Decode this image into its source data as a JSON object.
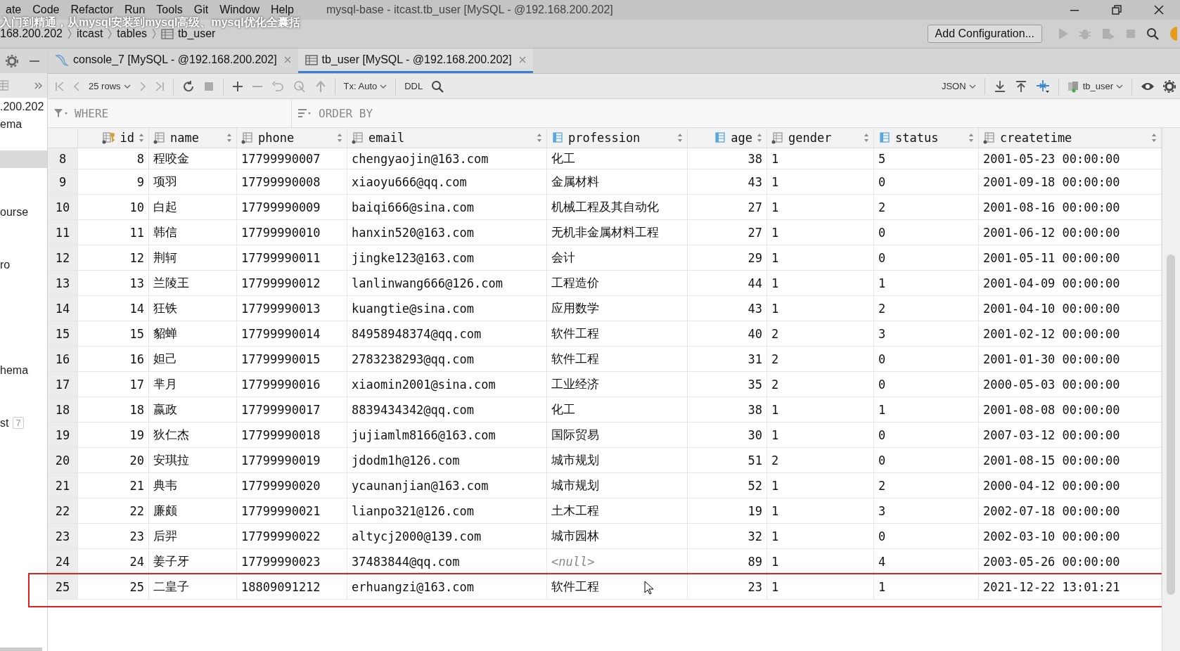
{
  "menu": {
    "items": [
      "ate",
      "Code",
      "Refactor",
      "Run",
      "Tools",
      "Git",
      "Window",
      "Help"
    ],
    "title": "mysql-base - itcast.tb_user [MySQL - @192.168.200.202]"
  },
  "caption": "入门到精通，从mysql安装到mysql高级、mysql优化全囊括",
  "breadcrumb": [
    "168.200.202",
    "itcast",
    "tables",
    "tb_user"
  ],
  "run_config": {
    "label": "Add Configuration..."
  },
  "sidebar": {
    "items": [
      ".200.202",
      "ema",
      "ourse",
      "ro",
      "hema",
      "st"
    ],
    "badge": "7"
  },
  "tabs": [
    {
      "label": "console_7 [MySQL - @192.168.200.202]",
      "kind": "console",
      "selected": false
    },
    {
      "label": "tb_user [MySQL - @192.168.200.202]",
      "kind": "table",
      "selected": true
    }
  ],
  "toolbar": {
    "rows": "25 rows",
    "tx": "Tx: Auto",
    "ddl": "DDL",
    "format": "JSON",
    "datasource": "tb_user"
  },
  "filter": {
    "where": "WHERE",
    "order_by": "ORDER BY"
  },
  "table": {
    "columns": [
      {
        "label": "id",
        "kind": "key",
        "numeric": true
      },
      {
        "label": "name",
        "kind": "column",
        "numeric": false
      },
      {
        "label": "phone",
        "kind": "column",
        "numeric": false
      },
      {
        "label": "email",
        "kind": "column",
        "numeric": false
      },
      {
        "label": "profession",
        "kind": "indexed",
        "numeric": false
      },
      {
        "label": "age",
        "kind": "indexed",
        "numeric": true
      },
      {
        "label": "gender",
        "kind": "column",
        "numeric": false
      },
      {
        "label": "status",
        "kind": "indexed",
        "numeric": false
      },
      {
        "label": "createtime",
        "kind": "column",
        "numeric": false
      }
    ],
    "rows": [
      {
        "number": "8",
        "cells": [
          "8",
          "程咬金",
          "17799990007",
          "chengyaojin@163.com",
          "化工",
          "38",
          "1",
          "5",
          "2001-05-23 00:00:00"
        ],
        "null_cell": false,
        "highlighted": false
      },
      {
        "number": "9",
        "cells": [
          "9",
          "项羽",
          "17799990008",
          "xiaoyu666@qq.com",
          "金属材料",
          "43",
          "1",
          "0",
          "2001-09-18 00:00:00"
        ],
        "null_cell": false,
        "highlighted": false
      },
      {
        "number": "10",
        "cells": [
          "10",
          "白起",
          "17799990009",
          "baiqi666@sina.com",
          "机械工程及其自动化",
          "27",
          "1",
          "2",
          "2001-08-16 00:00:00"
        ],
        "null_cell": false,
        "highlighted": false
      },
      {
        "number": "11",
        "cells": [
          "11",
          "韩信",
          "17799990010",
          "hanxin520@163.com",
          "无机非金属材料工程",
          "27",
          "1",
          "0",
          "2001-06-12 00:00:00"
        ],
        "null_cell": false,
        "highlighted": false
      },
      {
        "number": "12",
        "cells": [
          "12",
          "荆轲",
          "17799990011",
          "jingke123@163.com",
          "会计",
          "29",
          "1",
          "0",
          "2001-05-11 00:00:00"
        ],
        "null_cell": false,
        "highlighted": false
      },
      {
        "number": "13",
        "cells": [
          "13",
          "兰陵王",
          "17799990012",
          "lanlinwang666@126.com",
          "工程造价",
          "44",
          "1",
          "1",
          "2001-04-09 00:00:00"
        ],
        "null_cell": false,
        "highlighted": false
      },
      {
        "number": "14",
        "cells": [
          "14",
          "狂铁",
          "17799990013",
          "kuangtie@sina.com",
          "应用数学",
          "43",
          "1",
          "2",
          "2001-04-10 00:00:00"
        ],
        "null_cell": false,
        "highlighted": false
      },
      {
        "number": "15",
        "cells": [
          "15",
          "貂蝉",
          "17799990014",
          "84958948374@qq.com",
          "软件工程",
          "40",
          "2",
          "3",
          "2001-02-12 00:00:00"
        ],
        "null_cell": false,
        "highlighted": false
      },
      {
        "number": "16",
        "cells": [
          "16",
          "妲己",
          "17799990015",
          "2783238293@qq.com",
          "软件工程",
          "31",
          "2",
          "0",
          "2001-01-30 00:00:00"
        ],
        "null_cell": false,
        "highlighted": false
      },
      {
        "number": "17",
        "cells": [
          "17",
          "芈月",
          "17799990016",
          "xiaomin2001@sina.com",
          "工业经济",
          "35",
          "2",
          "0",
          "2000-05-03 00:00:00"
        ],
        "null_cell": false,
        "highlighted": false
      },
      {
        "number": "18",
        "cells": [
          "18",
          "嬴政",
          "17799990017",
          "8839434342@qq.com",
          "化工",
          "38",
          "1",
          "1",
          "2001-08-08 00:00:00"
        ],
        "null_cell": false,
        "highlighted": false
      },
      {
        "number": "19",
        "cells": [
          "19",
          "狄仁杰",
          "17799990018",
          "jujiamlm8166@163.com",
          "国际贸易",
          "30",
          "1",
          "0",
          "2007-03-12 00:00:00"
        ],
        "null_cell": false,
        "highlighted": false
      },
      {
        "number": "20",
        "cells": [
          "20",
          "安琪拉",
          "17799990019",
          "jdodm1h@126.com",
          "城市规划",
          "51",
          "2",
          "0",
          "2001-08-15 00:00:00"
        ],
        "null_cell": false,
        "highlighted": false
      },
      {
        "number": "21",
        "cells": [
          "21",
          "典韦",
          "17799990020",
          "ycaunanjian@163.com",
          "城市规划",
          "52",
          "1",
          "2",
          "2000-04-12 00:00:00"
        ],
        "null_cell": false,
        "highlighted": false
      },
      {
        "number": "22",
        "cells": [
          "22",
          "廉颇",
          "17799990021",
          "lianpo321@126.com",
          "土木工程",
          "19",
          "1",
          "3",
          "2002-07-18 00:00:00"
        ],
        "null_cell": false,
        "highlighted": false
      },
      {
        "number": "23",
        "cells": [
          "23",
          "后羿",
          "17799990022",
          "altycj2000@139.com",
          "城市园林",
          "32",
          "1",
          "0",
          "2002-03-10 00:00:00"
        ],
        "null_cell": false,
        "highlighted": false
      },
      {
        "number": "24",
        "cells": [
          "24",
          "姜子牙",
          "17799990023",
          "37483844@qq.com",
          "<null>",
          "89",
          "1",
          "4",
          "2003-05-26 00:00:00"
        ],
        "null_cell": true,
        "highlighted": false
      },
      {
        "number": "25",
        "cells": [
          "25",
          "二皇子",
          "18809091212",
          "erhuangzi@163.com",
          "软件工程",
          "23",
          "1",
          "1",
          "2021-12-22 13:01:21"
        ],
        "null_cell": false,
        "highlighted": true
      }
    ]
  }
}
